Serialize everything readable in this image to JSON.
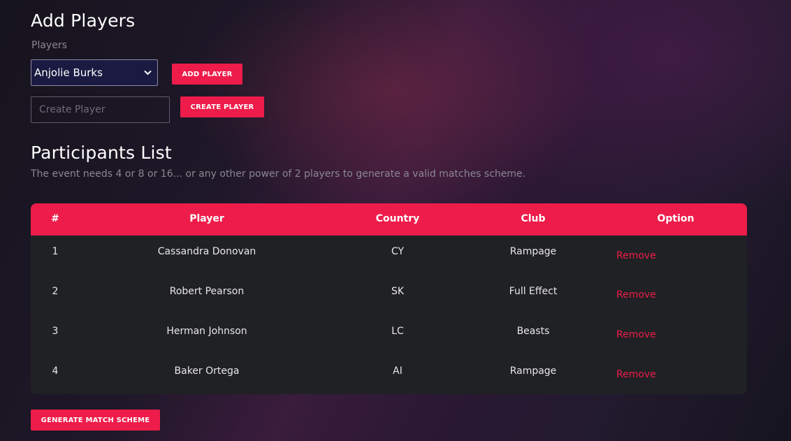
{
  "add_players": {
    "title": "Add Players",
    "players_label": "Players",
    "selected_player": "Anjolie Burks",
    "add_button": "ADD PLAYER",
    "create_placeholder": "Create Player",
    "create_button": "CREATE PLAYER"
  },
  "participants": {
    "title": "Participants List",
    "note": "The event needs 4 or 8 or 16... or any other power of 2 players to generate a valid matches scheme.",
    "columns": [
      "#",
      "Player",
      "Country",
      "Club",
      "Option"
    ],
    "rows": [
      {
        "num": "1",
        "player": "Cassandra Donovan",
        "country": "CY",
        "club": "Rampage",
        "option": "Remove"
      },
      {
        "num": "2",
        "player": "Robert Pearson",
        "country": "SK",
        "club": "Full Effect",
        "option": "Remove"
      },
      {
        "num": "3",
        "player": "Herman Johnson",
        "country": "LC",
        "club": "Beasts",
        "option": "Remove"
      },
      {
        "num": "4",
        "player": "Baker Ortega",
        "country": "AI",
        "club": "Rampage",
        "option": "Remove"
      }
    ]
  },
  "generate_button": "GENERATE MATCH SCHEME",
  "colors": {
    "accent": "#ee1c4a",
    "table_body": "#202124",
    "select_bg": "#1a1a42"
  },
  "icons": {
    "select_arrow": "chevron-down-icon"
  }
}
